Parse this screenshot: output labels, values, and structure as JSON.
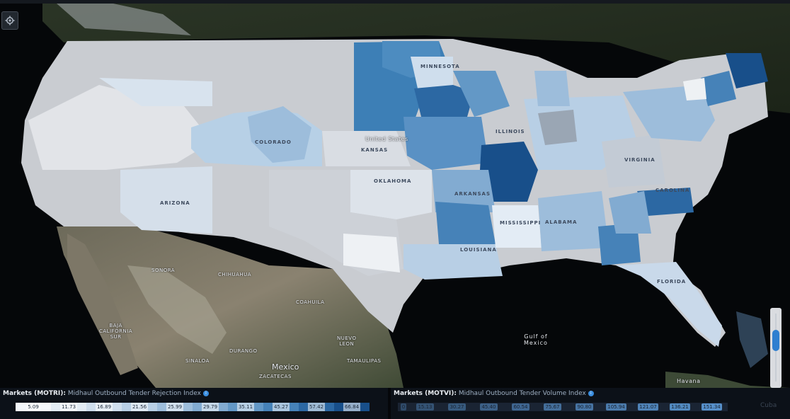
{
  "map": {
    "water_label": [
      "Gulf of",
      "Mexico"
    ],
    "country_label": "Mexico",
    "region_labels": {
      "sonora": "SONORA",
      "chihuahua": "CHIHUAHUA",
      "coahuila": "COAHUILA",
      "nuevo_leon": [
        "NUEVO",
        "LEON"
      ],
      "durango": "DURANGO",
      "sinaloa": "SINALOA",
      "baja": [
        "BAJA",
        "CALIFORNIA",
        "SUR"
      ],
      "tamaulipas": "TAMAULIPAS",
      "zacatecas": "ZACATECAS",
      "arizona": "ARIZONA",
      "oklahoma": "OKLAHOMA",
      "arkansas": "ARKANSAS",
      "mississippi": "MISSISSIPPI",
      "alabama": "ALABAMA",
      "louisiana": "LOUISIANA",
      "florida": "FLORIDA",
      "kansas": "KANSAS",
      "colorado": "COLORADO",
      "illinois": "ILLINOIS",
      "virginia": "VIRGINIA",
      "carolina": "CAROLINA",
      "minnesota": "MINNESOTA",
      "united_states": "United States",
      "cuba": "Cuba",
      "havana": "Havana"
    }
  },
  "legend_left": {
    "name": "Markets (MOTRI):",
    "subtitle": "Midhaul Outbound Tender Rejection Index",
    "info_icon": "i",
    "bins": [
      "5.09",
      "11.73",
      "16.89",
      "21.56",
      "25.99",
      "29.79",
      "35.11",
      "45.27",
      "57.42",
      "66.84"
    ],
    "colors": [
      "#f4f7fb",
      "#e3ecf5",
      "#cfdeed",
      "#b8cfe5",
      "#9dbddb",
      "#82abd1",
      "#6398c6",
      "#4682b8",
      "#2c68a3",
      "#184f8a"
    ]
  },
  "legend_right": {
    "name": "Markets (MOTVI):",
    "subtitle": "Midhaul Outbound Tender Volume Index",
    "info_icon": "i",
    "bins": [
      "0",
      "15.13",
      "30.27",
      "45.40",
      "60.54",
      "75.67",
      "90.80",
      "105.94",
      "121.07",
      "136.21",
      "151.34"
    ]
  },
  "zoom_level": 0.35
}
